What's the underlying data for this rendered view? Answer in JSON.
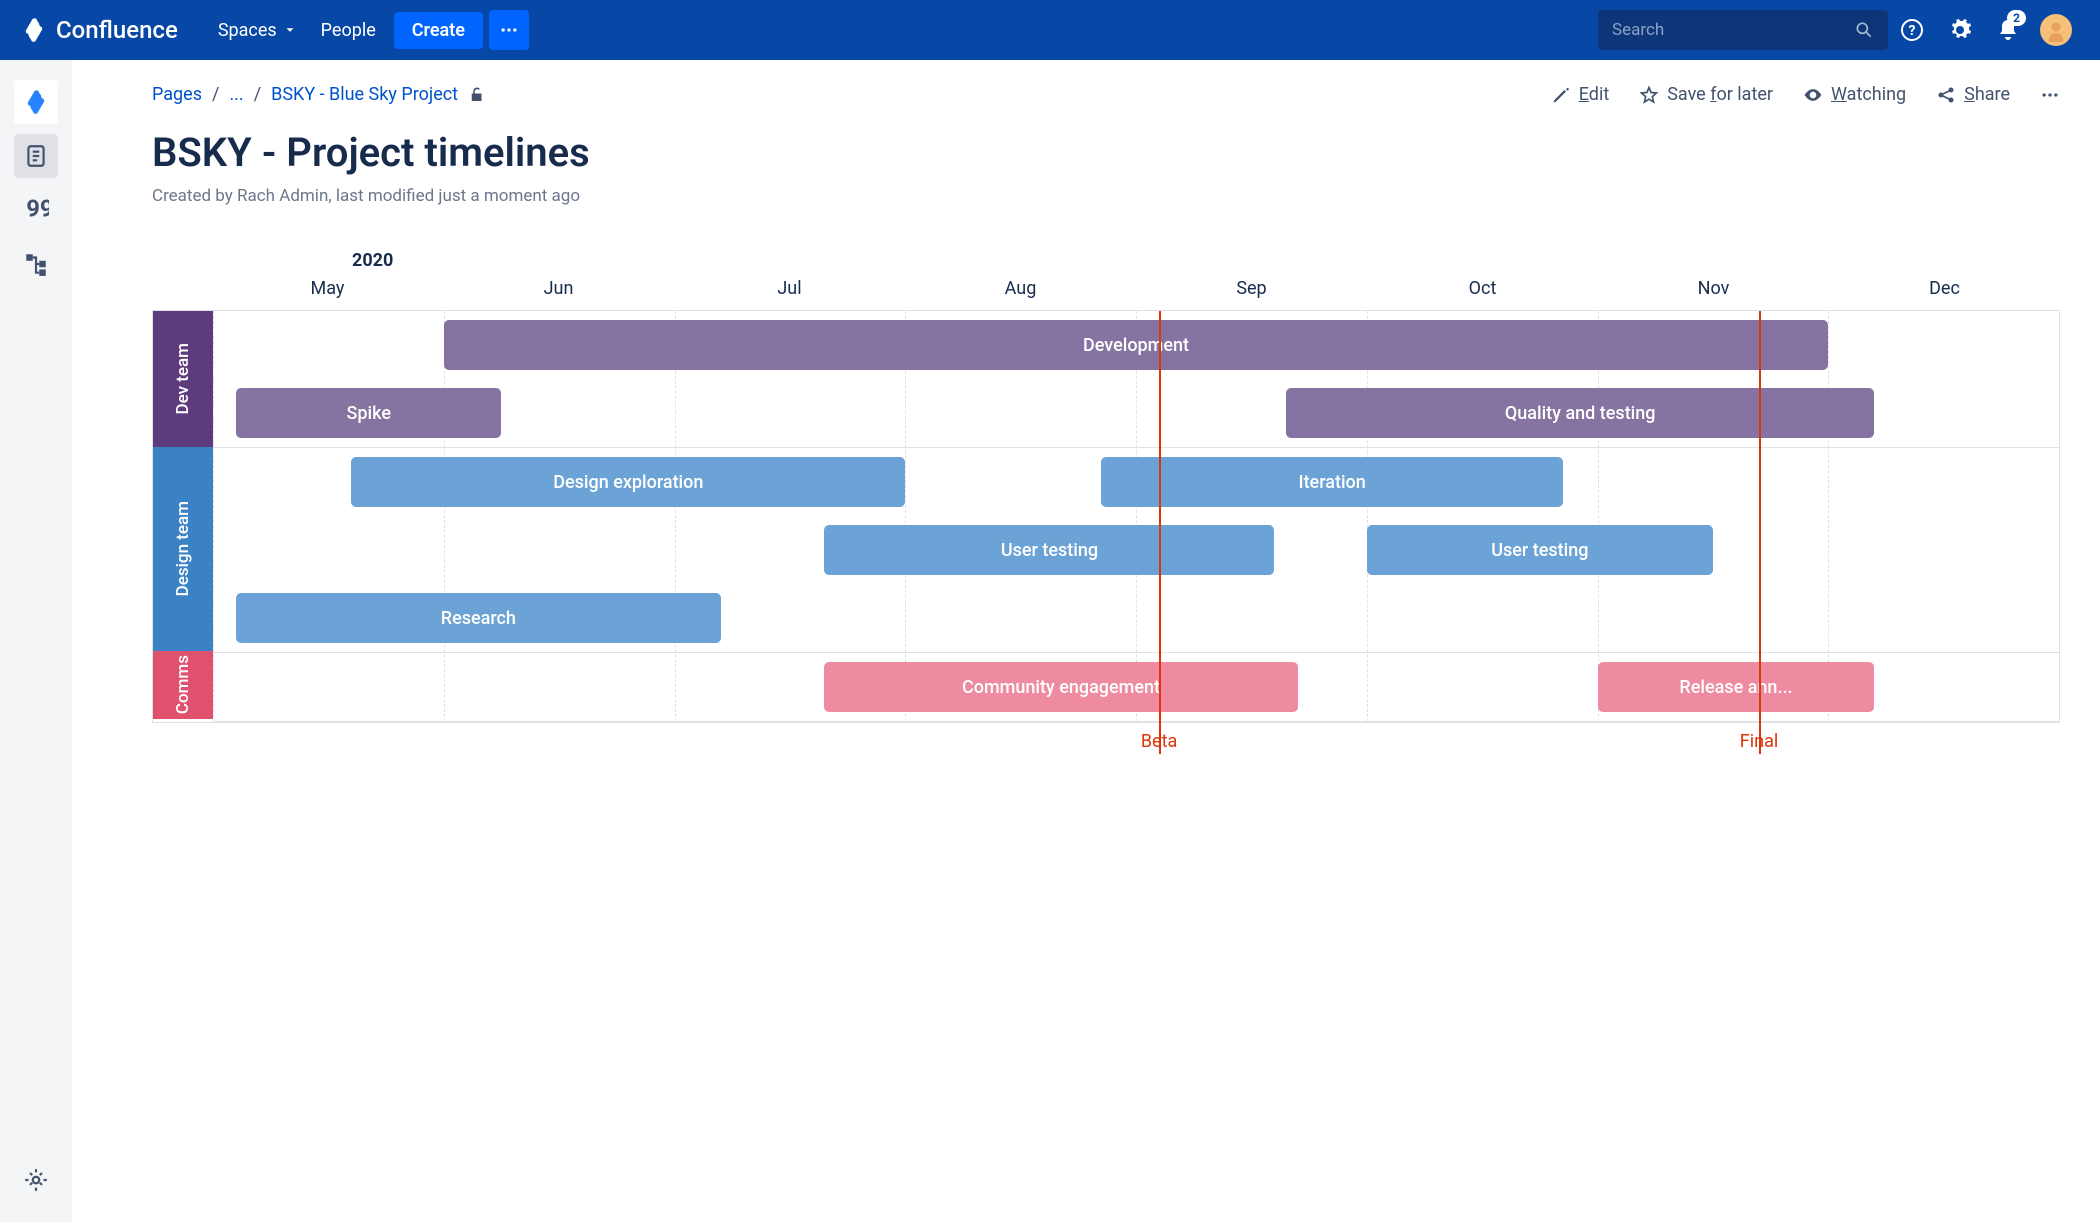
{
  "brand": "Confluence",
  "nav": {
    "spaces": "Spaces",
    "people": "People",
    "create": "Create"
  },
  "search_placeholder": "Search",
  "notif_count": "2",
  "crumbs": {
    "pages": "Pages",
    "ellipsis": "...",
    "parent": "BSKY - Blue Sky Project"
  },
  "actions": {
    "edit": "Edit",
    "save": "Save for later",
    "watching": "Watching",
    "share": "Share"
  },
  "page": {
    "title": "BSKY - Project timelines",
    "meta": "Created by Rach Admin, last modified just a moment ago"
  },
  "chart_data": {
    "type": "bar",
    "title": "",
    "year": "2020",
    "x": [
      "May",
      "Jun",
      "Jul",
      "Aug",
      "Sep",
      "Oct",
      "Nov",
      "Dec"
    ],
    "lanes": [
      {
        "name": "Dev team",
        "color": "#5e3b7d",
        "rows": [
          [
            {
              "label": "Development",
              "start": 1.0,
              "end": 7.0,
              "color": "#8573a1"
            }
          ],
          [
            {
              "label": "Spike",
              "start": 0.1,
              "end": 1.25,
              "color": "#8573a1"
            },
            {
              "label": "Quality and testing",
              "start": 4.65,
              "end": 7.2,
              "color": "#8573a1"
            }
          ]
        ]
      },
      {
        "name": "Design team",
        "color": "#3b82c4",
        "rows": [
          [
            {
              "label": "Design exploration",
              "start": 0.6,
              "end": 3.0,
              "color": "#6ba3d6"
            },
            {
              "label": "Iteration",
              "start": 3.85,
              "end": 5.85,
              "color": "#6ba3d6"
            }
          ],
          [
            {
              "label": "User testing",
              "start": 2.65,
              "end": 4.6,
              "color": "#6ba3d6"
            },
            {
              "label": "User testing",
              "start": 5.0,
              "end": 6.5,
              "color": "#6ba3d6"
            }
          ],
          [
            {
              "label": "Research",
              "start": 0.1,
              "end": 2.2,
              "color": "#6ba3d6"
            }
          ]
        ]
      },
      {
        "name": "Comms",
        "color": "#e0516e",
        "rows": [
          [
            {
              "label": "Community engagement",
              "start": 2.65,
              "end": 4.7,
              "color": "#ee8ba0"
            },
            {
              "label": "Release ann...",
              "start": 6.0,
              "end": 7.2,
              "color": "#ee8ba0"
            }
          ]
        ]
      }
    ],
    "markers": [
      {
        "label": "Beta",
        "at": 4.1
      },
      {
        "label": "Final",
        "at": 6.7
      }
    ]
  }
}
